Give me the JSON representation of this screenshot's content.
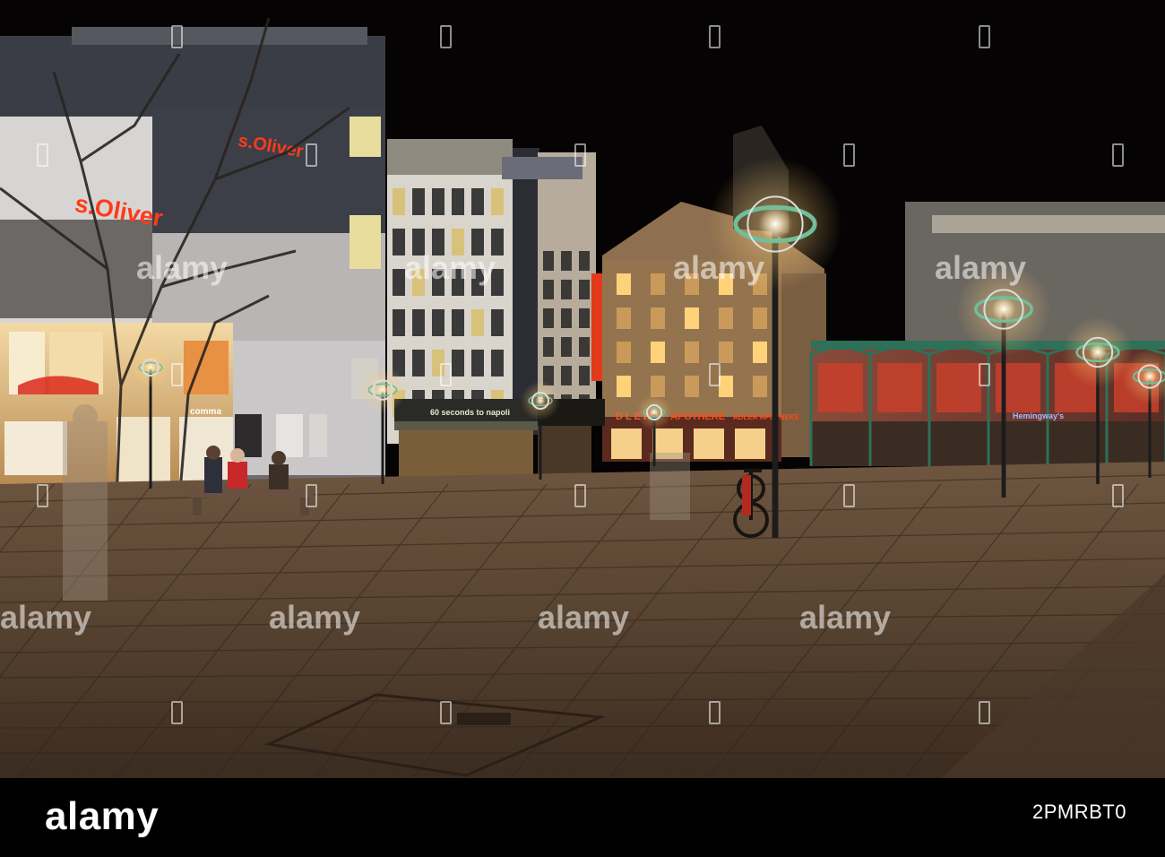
{
  "watermark": {
    "text": "alamy",
    "footer_logo": "alamy",
    "image_id": "2PMRBT0"
  },
  "signs": {
    "store_left": "s.Oliver",
    "store_upper": "s.Oliver",
    "store_small": "comma",
    "cafe": "60 seconds to napoli",
    "pharmacy": "APOTHEKE",
    "pharmacy_adler": "D L E R",
    "pharmacy_right": "ADLER APOTHEKE",
    "bar_sign": "Hemingway's"
  },
  "colors": {
    "sky": "#050303",
    "pavement": "#5a4632",
    "neon_red": "#ff3a1a",
    "warm_light": "#ffd590",
    "lamp_green": "#6fbf9a"
  }
}
